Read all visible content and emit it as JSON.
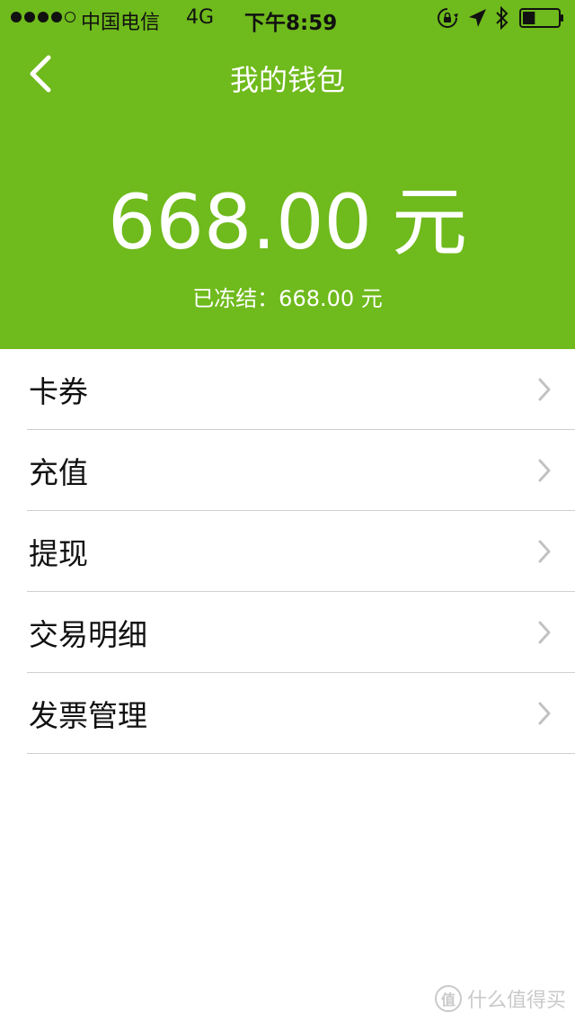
{
  "status_bar": {
    "carrier": "中国电信",
    "network": "4G",
    "time": "下午8:59",
    "signal_bars": 4,
    "signal_total": 5,
    "battery_level": 0.35
  },
  "nav": {
    "title": "我的钱包",
    "back_icon": "chevron-left-icon"
  },
  "wallet": {
    "balance": "668.00",
    "unit": "元",
    "frozen_text": "已冻结：668.00 元"
  },
  "menu": {
    "items": [
      {
        "label": "卡券"
      },
      {
        "label": "充值"
      },
      {
        "label": "提现"
      },
      {
        "label": "交易明细"
      },
      {
        "label": "发票管理"
      }
    ]
  },
  "watermark": {
    "logo_text": "值",
    "text": "什么值得买"
  },
  "colors": {
    "header_bg": "#6fba1c",
    "divider": "#cfcfcf",
    "chevron": "#c2c2c2"
  }
}
